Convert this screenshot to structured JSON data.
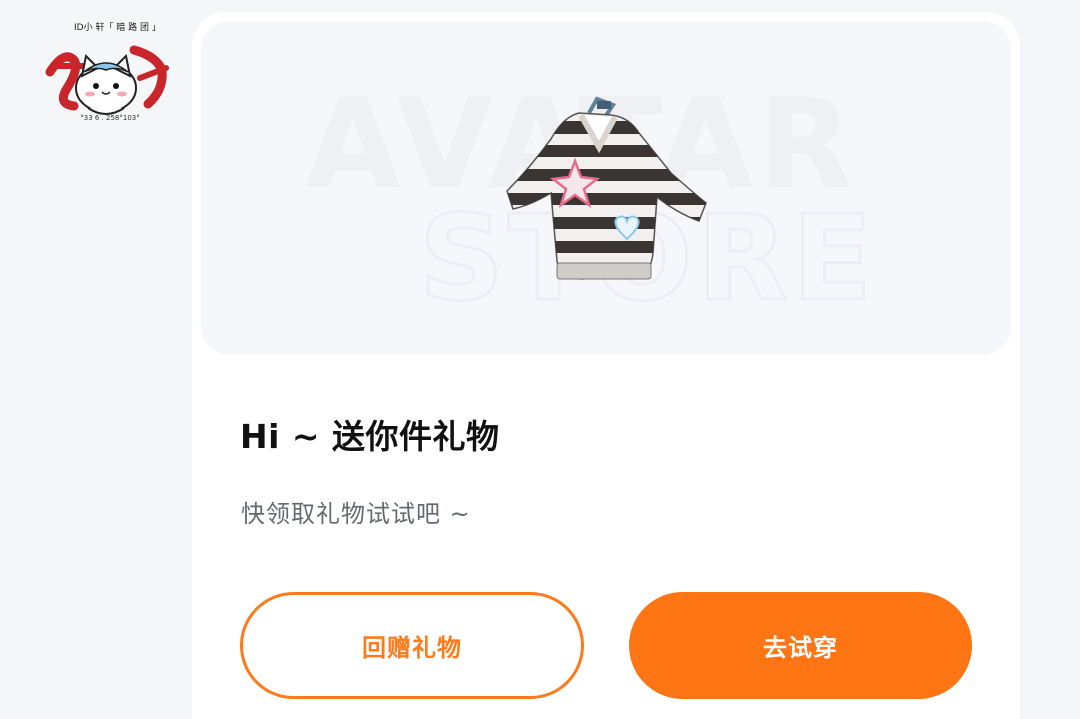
{
  "avatar": {
    "caption": "ID小 轩「 暗 路 团 」",
    "footer": "°33 6 . 258°103°"
  },
  "hero": {
    "watermark_line1": "AVATAR",
    "watermark_line2": "STORE",
    "item_icon": "striped-sweater-icon"
  },
  "gift": {
    "title": "Hi ~ 送你件礼物",
    "subtitle": "快领取礼物试试吧 ~"
  },
  "actions": {
    "return_gift_label": "回赠礼物",
    "try_on_label": "去试穿"
  },
  "colors": {
    "accent": "#ff7413",
    "page_bg": "#f5f6f8",
    "card_bg": "#ffffff",
    "hero_bg": "#f6f7fb"
  }
}
